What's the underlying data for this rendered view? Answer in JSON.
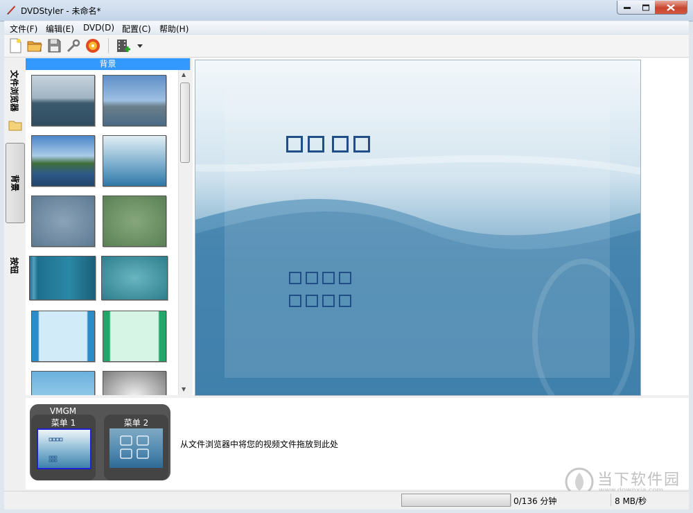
{
  "window": {
    "title": "DVDStyler - 未命名*"
  },
  "menubar": {
    "items": [
      "文件(F)",
      "编辑(E)",
      "DVD(D)",
      "配置(C)",
      "帮助(H)"
    ]
  },
  "toolbar": {
    "buttons": [
      "new-file-icon",
      "open-folder-icon",
      "save-icon",
      "settings-wrench-icon",
      "burn-disc-icon",
      "add-video-icon",
      "dropdown-arrow-icon"
    ]
  },
  "side_tabs": {
    "file_browser": "文件浏览器",
    "background": "背景",
    "buttons": "按钮"
  },
  "backgrounds_panel": {
    "header": "背景"
  },
  "titleset": {
    "group_label": "VMGM",
    "menus": [
      "菜单 1",
      "菜单 2"
    ],
    "drop_hint": "从文件浏览器中将您的视频文件拖放到此处"
  },
  "status": {
    "progress": 0,
    "duration": "0/136 分钟",
    "rate": "8 MB/秒"
  },
  "watermark": {
    "text": "当下软件园",
    "url": "www.downxia.com"
  },
  "colors": {
    "selection_header": "#3399ff",
    "placeholder_box": "#1f4f86",
    "close_button": "#c8452e"
  }
}
